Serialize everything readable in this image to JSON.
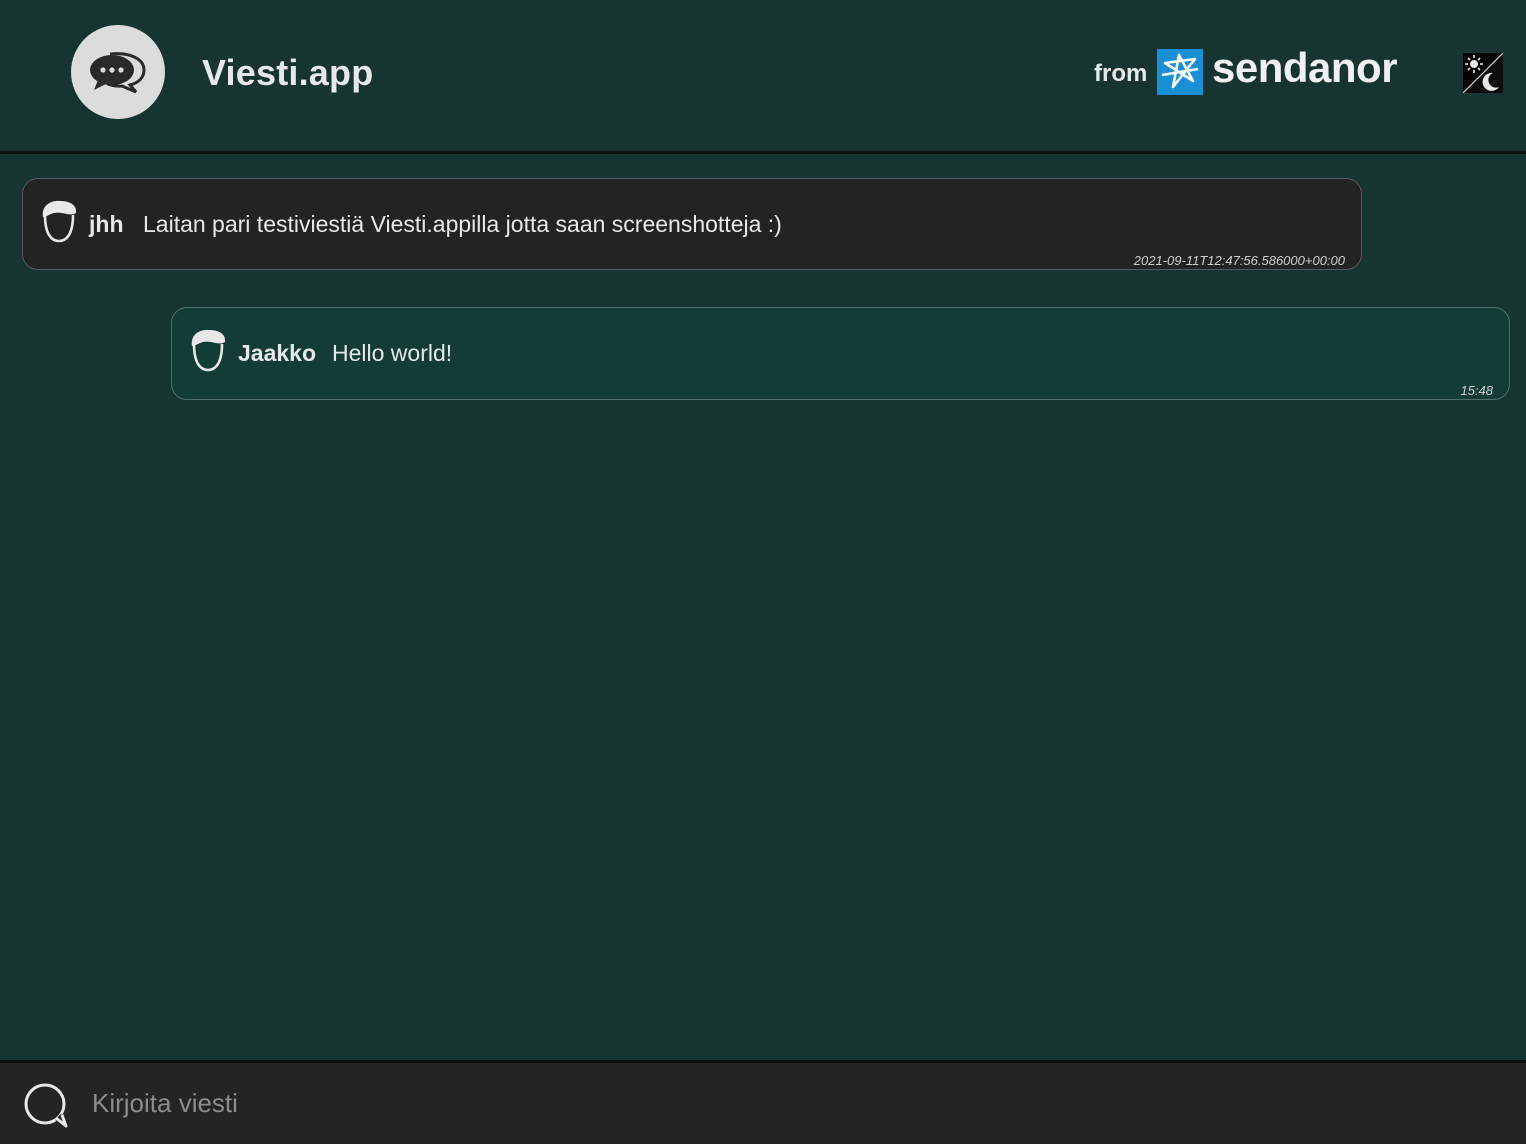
{
  "header": {
    "app_title": "Viesti.app",
    "from_label": "from",
    "brand_name": "sendanor",
    "logo_icon": "chat-bubbles-icon",
    "brand_icon": "sendanor-star-icon",
    "theme_toggle_icon": "sun-moon-icon"
  },
  "messages": [
    {
      "sender": "jhh",
      "text": "Laitan pari testiviestiä Viesti.appilla jotta saan screenshotteja :)",
      "timestamp": "2021-09-11T12:47:56.586000+00:00",
      "avatar_icon": "user-avatar-icon"
    },
    {
      "sender": "Jaakko",
      "text": "Hello world!",
      "timestamp": "15:48",
      "avatar_icon": "user-avatar-icon"
    }
  ],
  "composer": {
    "placeholder": "Kirjoita viesti",
    "value": "",
    "icon": "chat-bubble-icon"
  },
  "colors": {
    "background": "#163531",
    "header_background": "#163531",
    "other_message_background": "#232323",
    "own_message_background": "#133c36",
    "footer_background": "#242424",
    "brand_blue": "#1a8fd6",
    "text": "#e8e8e8"
  }
}
